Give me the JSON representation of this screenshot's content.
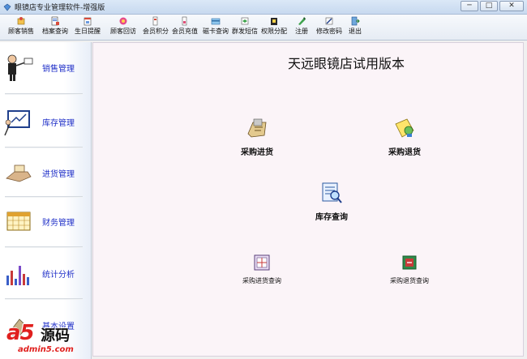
{
  "window": {
    "title": "眼镜店专业管理软件-增强版",
    "buttons": {
      "minimize": "─",
      "maximize": "□",
      "close": "✕"
    }
  },
  "toolbar": {
    "items": [
      {
        "label": "顾客销售",
        "icon": "customer-sales-icon"
      },
      {
        "label": "档案查询",
        "icon": "archive-query-icon"
      },
      {
        "label": "生日提醒",
        "icon": "birthday-reminder-icon"
      },
      {
        "label": "顾客回访",
        "icon": "customer-visit-icon"
      },
      {
        "label": "会员积分",
        "icon": "member-points-icon"
      },
      {
        "label": "会员充值",
        "icon": "member-recharge-icon"
      },
      {
        "label": "磁卡查询",
        "icon": "card-query-icon"
      },
      {
        "label": "群发短信",
        "icon": "bulk-sms-icon"
      },
      {
        "label": "权限分配",
        "icon": "permission-icon"
      },
      {
        "label": "注册",
        "icon": "register-icon"
      },
      {
        "label": "修改密码",
        "icon": "change-password-icon"
      },
      {
        "label": "退出",
        "icon": "exit-icon"
      }
    ]
  },
  "sidebar": {
    "items": [
      {
        "label": "销售管理",
        "icon": "sales-person-icon"
      },
      {
        "label": "库存管理",
        "icon": "inventory-board-icon"
      },
      {
        "label": "进货管理",
        "icon": "purchase-hand-icon"
      },
      {
        "label": "财务管理",
        "icon": "calendar-icon"
      },
      {
        "label": "统计分析",
        "icon": "bar-chart-icon"
      },
      {
        "label": "基本设置",
        "icon": "settings-icon"
      }
    ]
  },
  "main": {
    "title": "天远眼镜店试用版本",
    "actions": [
      {
        "label": "采购进货",
        "icon": "purchase-stock-icon"
      },
      {
        "label": "采购退货",
        "icon": "purchase-return-icon"
      },
      {
        "label": "库存查询",
        "icon": "inventory-query-icon"
      },
      {
        "label": "采购进货查询",
        "icon": "purchase-stock-query-icon"
      },
      {
        "label": "采购退货查询",
        "icon": "purchase-return-query-icon"
      }
    ]
  },
  "watermark": {
    "logo": "a5",
    "logo_text": "源码",
    "url": "admin5.com"
  },
  "colors": {
    "sidebar_label": "#2030c8",
    "main_bg": "#fbf4f8",
    "watermark_red": "#e0201e"
  }
}
